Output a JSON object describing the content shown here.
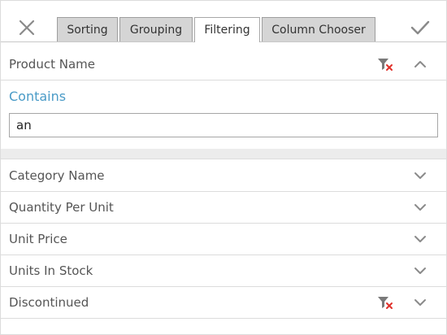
{
  "header": {
    "close_icon": "close-icon",
    "apply_icon": "checkmark-icon",
    "tabs": [
      {
        "label": "Sorting",
        "active": false
      },
      {
        "label": "Grouping",
        "active": false
      },
      {
        "label": "Filtering",
        "active": true
      },
      {
        "label": "Column Chooser",
        "active": false
      }
    ]
  },
  "expanded_field": {
    "name": "Product Name",
    "operator": "Contains",
    "value": "an",
    "has_filter": true
  },
  "fields": [
    {
      "name": "Category Name",
      "has_filter": false
    },
    {
      "name": "Quantity Per Unit",
      "has_filter": false
    },
    {
      "name": "Unit Price",
      "has_filter": false
    },
    {
      "name": "Units In Stock",
      "has_filter": false
    },
    {
      "name": "Discontinued",
      "has_filter": true
    }
  ],
  "colors": {
    "accent": "#4a9bc7",
    "clear_filter_x": "#e0302a",
    "icon_gray": "#8a8a8a"
  }
}
